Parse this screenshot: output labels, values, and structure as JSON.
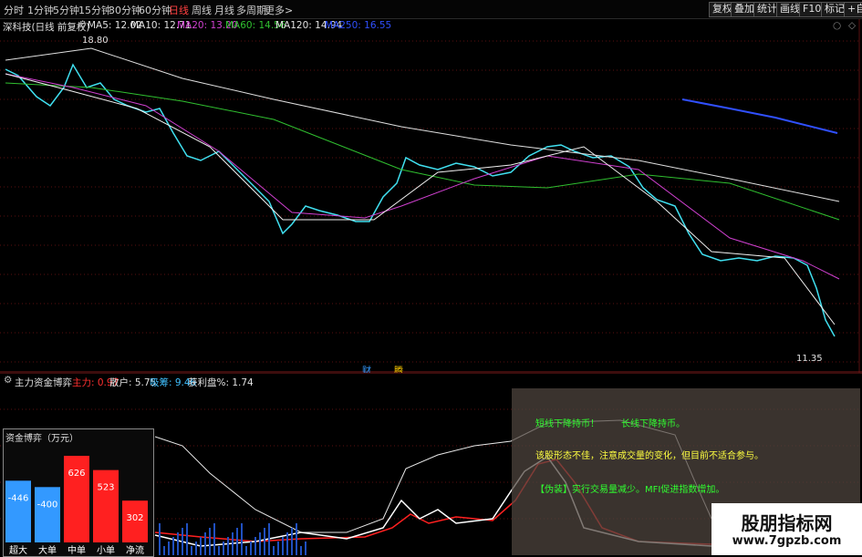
{
  "toolbar": {
    "periods": [
      "分时",
      "1分钟",
      "5分钟",
      "15分钟",
      "30分钟",
      "60分钟",
      "日线",
      "周线",
      "月线",
      "多周期",
      "更多>"
    ],
    "active_period": "日线",
    "right_buttons": [
      "复权",
      "叠加",
      "统计",
      "画线",
      "F10",
      "标记",
      "+自"
    ]
  },
  "kline": {
    "stock_title": "深科技(日线 前复权)",
    "ma": [
      {
        "label": "MA5: 12.02",
        "color": "#e0e0e0"
      },
      {
        "label": "MA10: 12.71",
        "color": "#e0e0e0"
      },
      {
        "label": "MA20: 13.20",
        "color": "#d040d0"
      },
      {
        "label": "MA60: 14.56",
        "color": "#30c030"
      },
      {
        "label": "MA120: 14.94",
        "color": "#e0e0e0"
      },
      {
        "label": "MA250: 16.55",
        "color": "#3050ff"
      }
    ],
    "high_label": "18.80",
    "low_label": "11.35",
    "markers": [
      "财",
      "腾"
    ]
  },
  "indicator": {
    "title": "主力资金博弈",
    "legend": [
      {
        "label": "主力: 0.97",
        "color": "#ff3030"
      },
      {
        "label": "散户: 5.75",
        "color": "#e0e0e0"
      },
      {
        "label": "吸筹: 9.46",
        "color": "#40c0ff"
      },
      {
        "label": "获利盘%: 1.74",
        "color": "#e0e0e0"
      }
    ]
  },
  "fund_box": {
    "title": "资金博弈（万元）",
    "bars": [
      {
        "label": "超大",
        "value": -446,
        "value_text": "-446",
        "color": "#3399ff"
      },
      {
        "label": "大单",
        "value": -400,
        "value_text": "-400",
        "color": "#3399ff"
      },
      {
        "label": "中单",
        "value": 626,
        "value_text": "626",
        "color": "#ff2020"
      },
      {
        "label": "小单",
        "value": 523,
        "value_text": "523",
        "color": "#ff2020"
      },
      {
        "label": "净流",
        "value": 302,
        "value_text": "302",
        "color": "#ff2020"
      }
    ]
  },
  "notes": {
    "line1a": "短线下降持币！",
    "line1b": "长线下降持币。",
    "line2": "该股形态不佳，注意成交量的变化，但目前不适合参与。",
    "line3": "【伪装】实行交易量减少。MFI促进指数增加。"
  },
  "watermark": {
    "title": "股朋指标网",
    "url": "www.7gpzb.com"
  }
}
